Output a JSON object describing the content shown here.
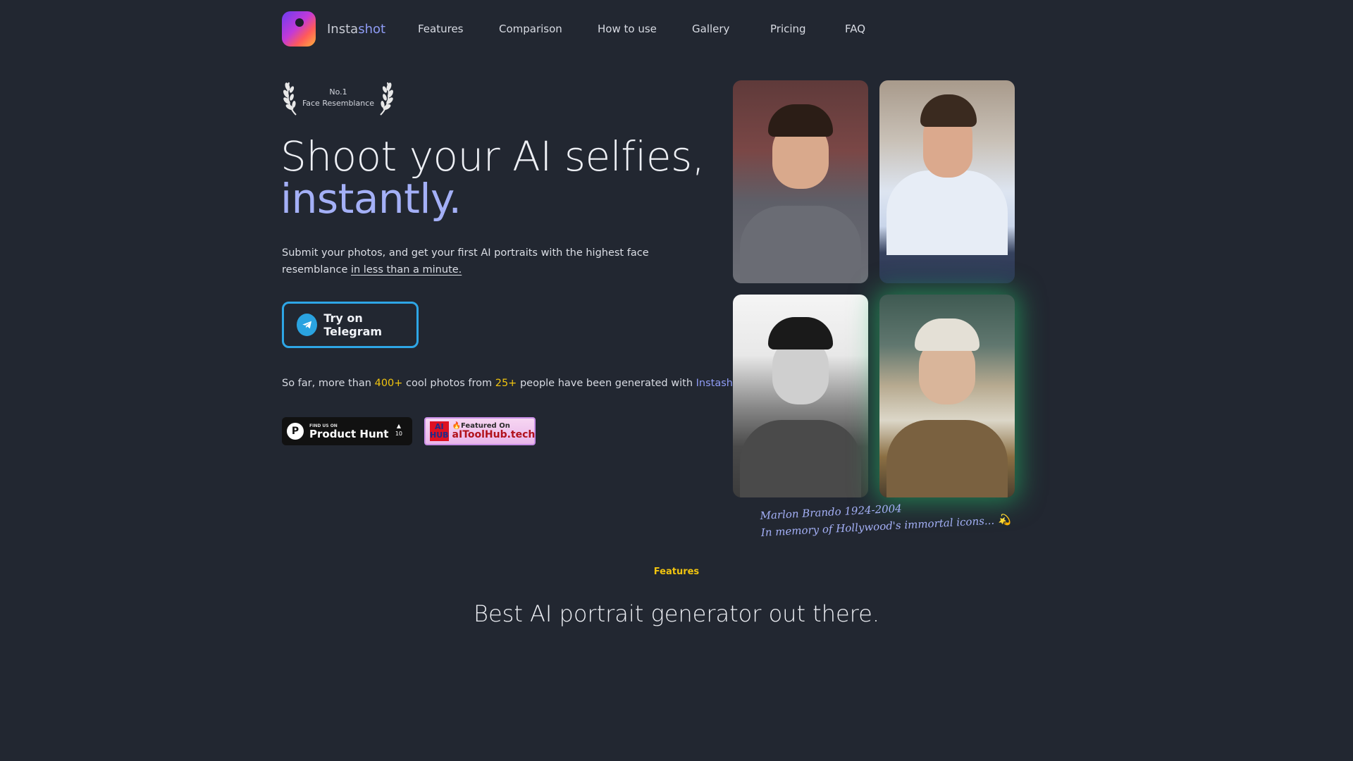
{
  "brand": {
    "name_prefix": "Insta",
    "name_suffix": "shot"
  },
  "nav": {
    "links": [
      {
        "label": "Features"
      },
      {
        "label": "Comparison"
      },
      {
        "label": "How to use"
      },
      {
        "label": "Gallery"
      },
      {
        "label": "Pricing"
      },
      {
        "label": "FAQ"
      }
    ]
  },
  "badge": {
    "line1": "No.1",
    "line2": "Face Resemblance"
  },
  "hero": {
    "title_line1": "Shoot your AI selfies,",
    "title_line2": "instantly.",
    "subtitle_main": "Submit your photos, and get your first AI portraits with the highest face resemblance ",
    "subtitle_underlined": "in less than a minute.",
    "cta_label": "Try on Telegram"
  },
  "stats": {
    "part1": "So far, more than ",
    "photos": "400+",
    "part2": " cool photos from ",
    "people": "25+",
    "part3": " people have been generated with ",
    "brand": "Instashot"
  },
  "product_hunt": {
    "small": "FIND US ON",
    "big": "Product Hunt",
    "votes": "10"
  },
  "aitoolhub": {
    "logo_top": "AI",
    "logo_bottom": "HUB",
    "small": "🔥Featured On",
    "big": "aIToolHub.tech"
  },
  "gallery": {
    "caption_line1": "Marlon Brando 1924-2004",
    "caption_line2": "In memory of Hollywood's immortal icons...",
    "caption_emoji": "💫"
  },
  "features": {
    "label": "Features",
    "title": "Best AI portrait generator out there."
  },
  "colors": {
    "background": "#222731",
    "accent": "#a4b0f7",
    "yellow": "#f1c40f",
    "telegram": "#2ea6e6",
    "glow": "#27c96e"
  }
}
